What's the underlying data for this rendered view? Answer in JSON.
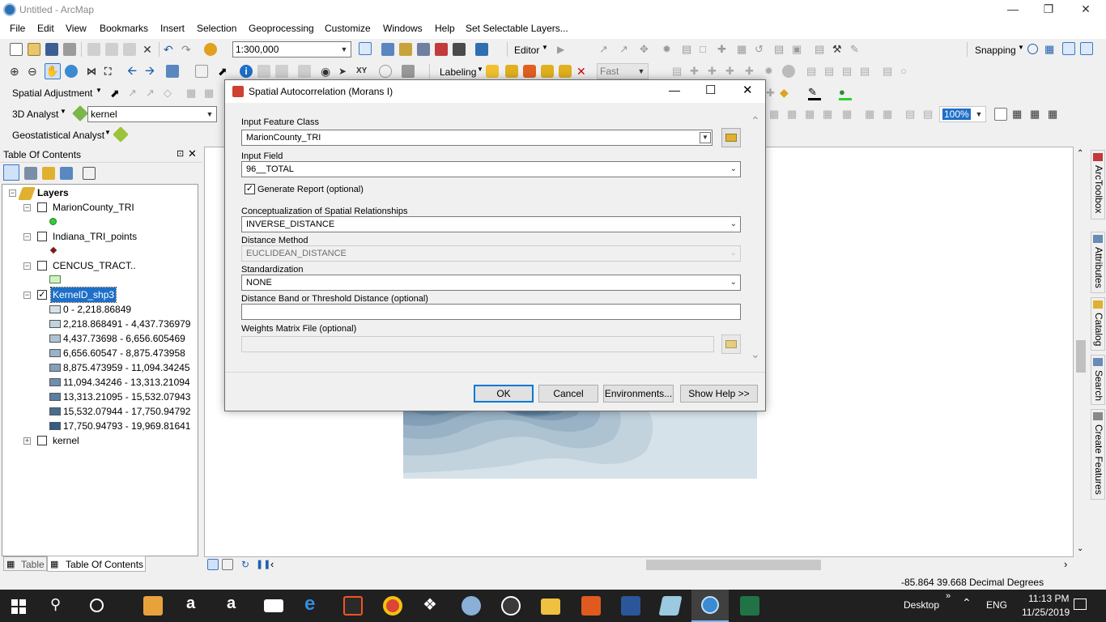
{
  "window": {
    "title": "Untitled - ArcMap"
  },
  "menu": [
    "File",
    "Edit",
    "View",
    "Bookmarks",
    "Insert",
    "Selection",
    "Geoprocessing",
    "Customize",
    "Windows",
    "Help",
    "Set Selectable Layers..."
  ],
  "toolbar": {
    "scale": "1:300,000",
    "editor": "Editor",
    "snapping": "Snapping",
    "labeling": "Labeling",
    "fast": "Fast",
    "spatial_adjustment": "Spatial Adjustment",
    "analyst_3d": "3D Analyst",
    "analyst_3d_layer": "kernel",
    "geostat": "Geostatistical Analyst",
    "zoom_pct": "100%"
  },
  "toc": {
    "title": "Table Of Contents",
    "root": "Layers",
    "layers": [
      {
        "name": "MarionCounty_TRI",
        "checked": false
      },
      {
        "name": "Indiana_TRI_points",
        "checked": false
      },
      {
        "name": "CENCUS_TRACT..",
        "checked": false
      },
      {
        "name": "KernelD_shp3",
        "checked": true
      },
      {
        "name": "kernel",
        "checked": false
      }
    ],
    "classes": [
      {
        "label": "0 - 2,218.86849",
        "color": "#d6e2e9"
      },
      {
        "label": "2,218.868491 - 4,437.736979",
        "color": "#c2d3de"
      },
      {
        "label": "4,437.73698 - 6,656.605469",
        "color": "#aec3d2"
      },
      {
        "label": "6,656.60547 - 8,875.473958",
        "color": "#99b2c6"
      },
      {
        "label": "8,875.473959 - 11,094.34245",
        "color": "#84a0b9"
      },
      {
        "label": "11,094.34246 - 13,313.21094",
        "color": "#6f8fad"
      },
      {
        "label": "13,313.21095 - 15,532.07943",
        "color": "#5b7ea1"
      },
      {
        "label": "15,532.07944 - 17,750.94792",
        "color": "#476d94"
      },
      {
        "label": "17,750.94793 - 19,969.81641",
        "color": "#345c86"
      }
    ],
    "tabs": [
      "Table",
      "Table Of Contents"
    ]
  },
  "right_tabs": [
    "ArcToolbox",
    "Attributes",
    "Catalog",
    "Search",
    "Create Features"
  ],
  "dialog": {
    "title": "Spatial Autocorrelation (Morans I)",
    "input_feature_class_label": "Input Feature Class",
    "input_feature_class": "MarionCounty_TRI",
    "input_field_label": "Input Field",
    "input_field": "96__TOTAL",
    "generate_report_label": "Generate Report (optional)",
    "generate_report": true,
    "conceptualization_label": "Conceptualization of Spatial Relationships",
    "conceptualization": "INVERSE_DISTANCE",
    "distance_method_label": "Distance Method",
    "distance_method": "EUCLIDEAN_DISTANCE",
    "standardization_label": "Standardization",
    "standardization": "NONE",
    "distance_band_label": "Distance Band or Threshold Distance (optional)",
    "distance_band": "",
    "weights_label": "Weights Matrix File (optional)",
    "weights": "",
    "buttons": {
      "ok": "OK",
      "cancel": "Cancel",
      "env": "Environments...",
      "help": "Show Help >>"
    }
  },
  "status": {
    "coords": "-85.864  39.668 Decimal Degrees"
  },
  "taskbar": {
    "desktop": "Desktop",
    "lang": "ENG",
    "time": "11:13 PM",
    "date": "11/25/2019"
  }
}
